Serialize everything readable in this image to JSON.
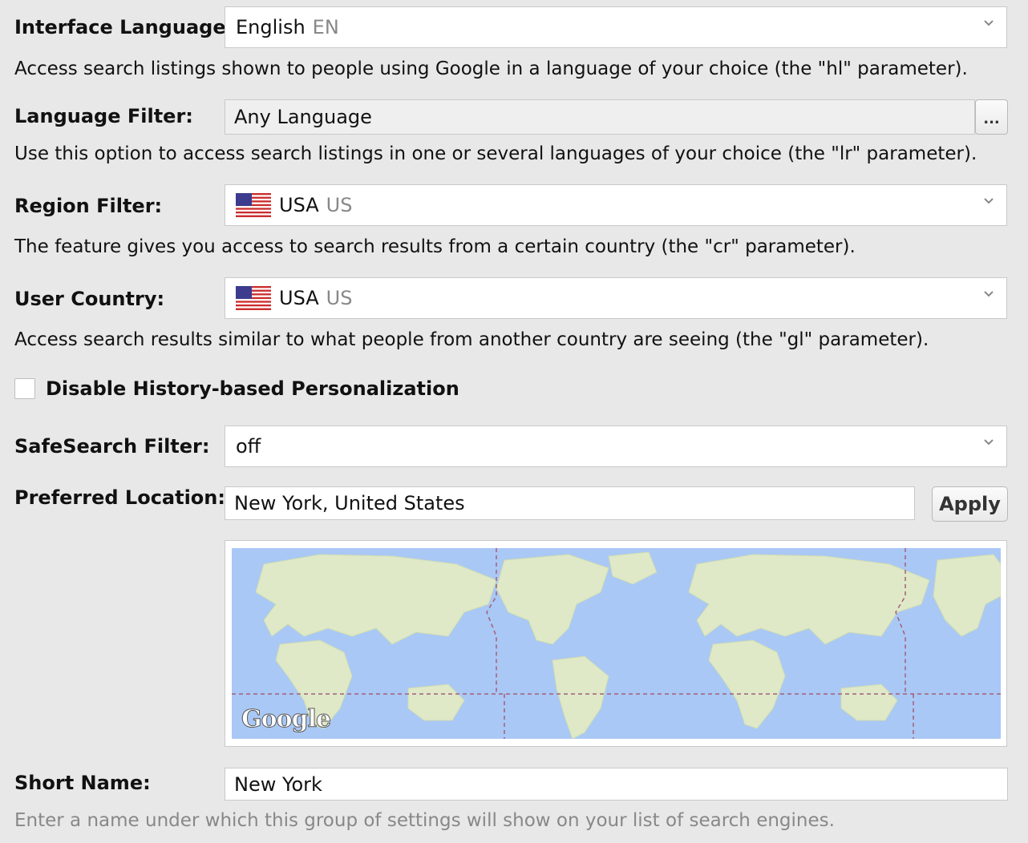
{
  "interface_language": {
    "label": "Interface Language:",
    "value": "English",
    "code": "EN",
    "description": "Access search listings shown to people using Google in a language of your choice (the \"hl\" parameter)."
  },
  "language_filter": {
    "label": "Language Filter:",
    "value": "Any Language",
    "button_label": "...",
    "description": "Use this option to access search listings in one or several languages of your choice (the \"lr\" parameter)."
  },
  "region_filter": {
    "label": "Region Filter:",
    "value": "USA",
    "code": "US",
    "flag_icon": "us-flag-icon",
    "description": "The feature gives you access to search results from a certain country (the \"cr\" parameter)."
  },
  "user_country": {
    "label": "User Country:",
    "value": "USA",
    "code": "US",
    "flag_icon": "us-flag-icon",
    "description": "Access search results similar to what people from another country are seeing (the \"gl\" parameter)."
  },
  "personalization": {
    "label": "Disable History-based Personalization",
    "checked": false
  },
  "safesearch": {
    "label": "SafeSearch Filter:",
    "value": "off"
  },
  "preferred_location": {
    "label": "Preferred Location:",
    "value": "New York, United States",
    "apply_label": "Apply",
    "map_logo": "Google"
  },
  "short_name": {
    "label": "Short Name:",
    "value": "New York",
    "description": "Enter a name under which this group of settings will show on your list of search engines."
  },
  "colors": {
    "background": "#e8e8e8",
    "ocean": "#a9c8f5",
    "land": "#dfe9c7",
    "muted_text": "#888888"
  }
}
